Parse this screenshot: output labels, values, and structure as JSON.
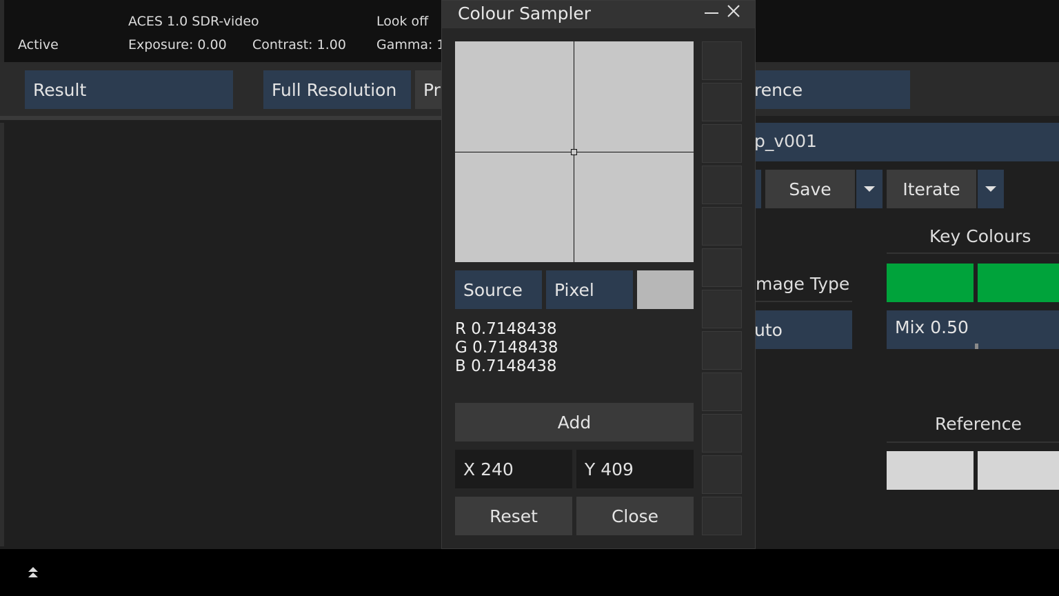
{
  "status": {
    "active": "Active",
    "colour_space": "ACES 1.0 SDR-video",
    "exposure": "Exposure: 0.00",
    "contrast": "Contrast: 1.00",
    "look": "Look off",
    "gamma": "Gamma: 1"
  },
  "toolbar": {
    "result": "Result",
    "full_resolution": "Full Resolution",
    "pr_partial": "Pr",
    "reference_partial": "rence"
  },
  "panel": {
    "name_partial": "p_v001",
    "save": "Save",
    "iterate": "Iterate",
    "key_colours": "Key Colours",
    "image_type": "mage Type",
    "auto_partial": "uto",
    "mix": "Mix 0.50",
    "reference": "Reference",
    "key_colour_value": "#00a33b",
    "reference_colour_value": "#d6d6d6"
  },
  "dialog": {
    "title": "Colour Sampler",
    "source": "Source",
    "pixel": "Pixel",
    "sample_colour": "#b7b7b7",
    "r": "R 0.7148438",
    "g": "G 0.7148438",
    "b": "B 0.7148438",
    "add": "Add",
    "x": "X 240",
    "y": "Y 409",
    "reset": "Reset",
    "close": "Close",
    "swatch_slots": 12
  },
  "bottombar": {
    "expand_icon": "double-chevron-up-icon"
  }
}
